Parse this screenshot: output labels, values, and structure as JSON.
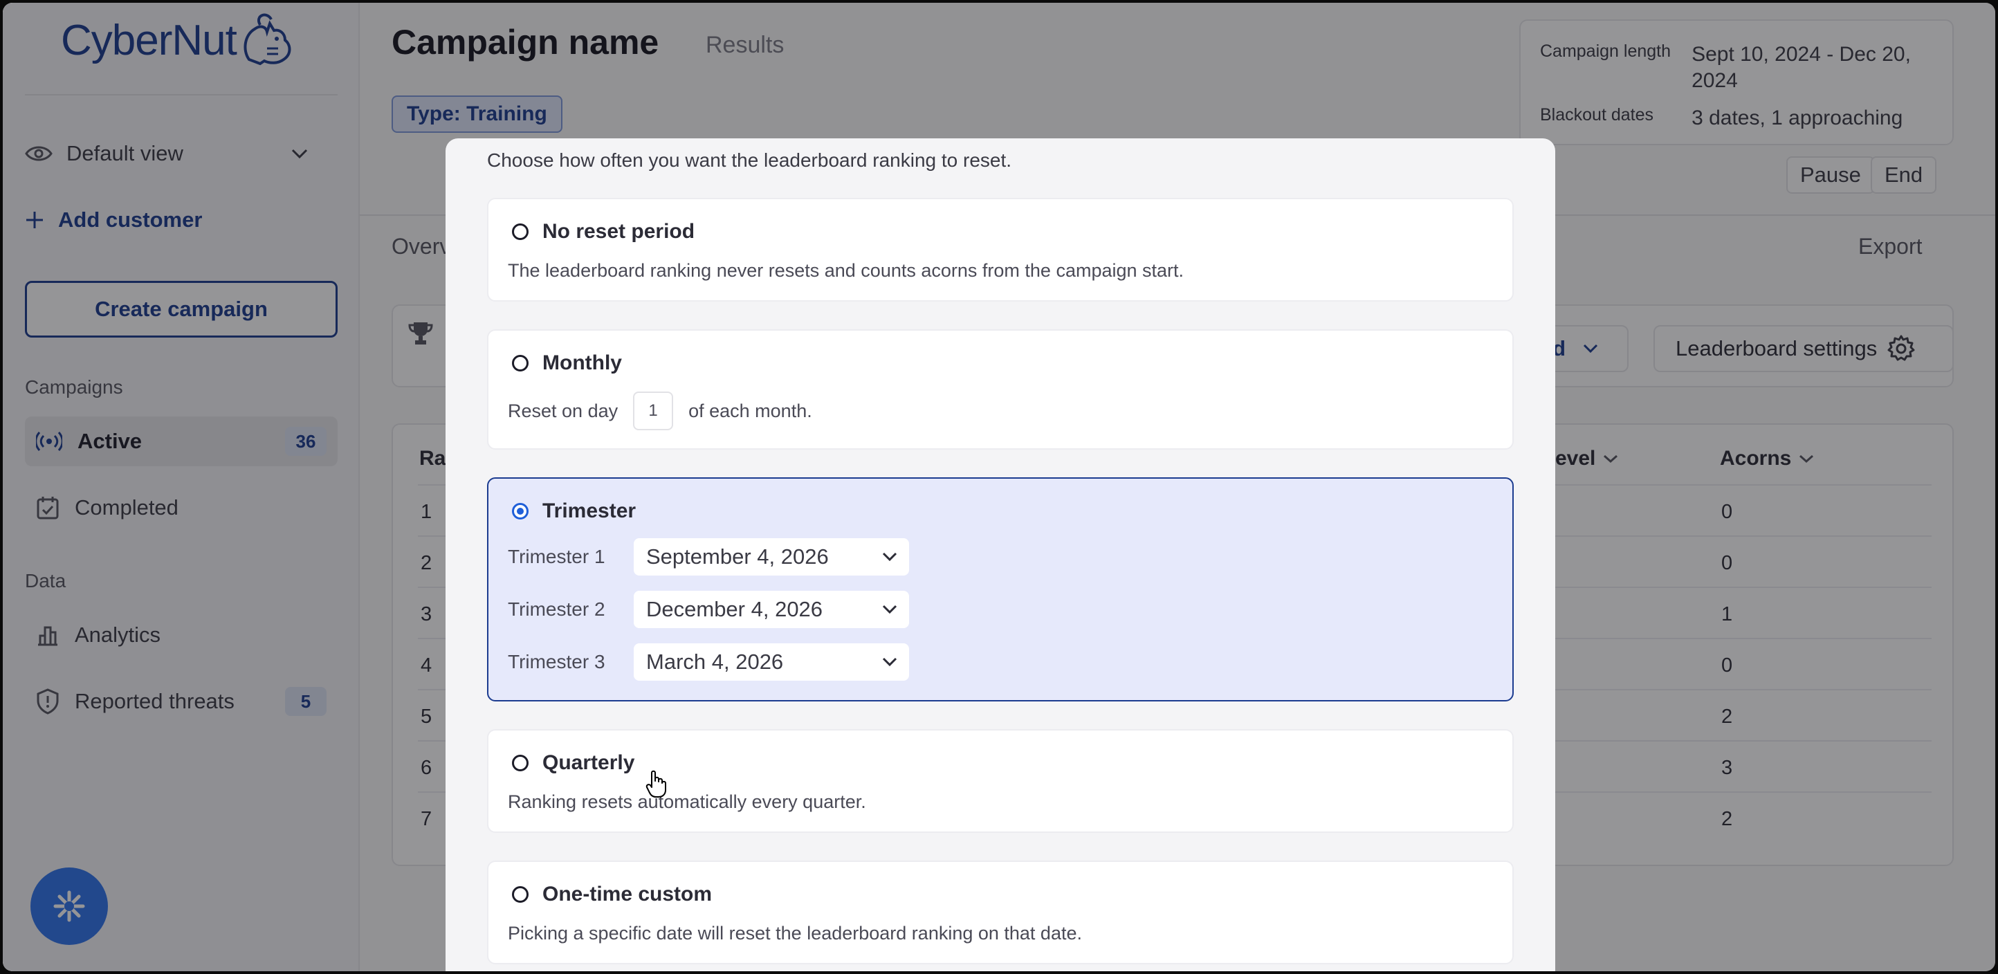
{
  "sidebar": {
    "logo_text": "CyberNut",
    "view_selector": "Default view",
    "add_customer": "Add customer",
    "create_campaign": "Create campaign",
    "campaigns_heading": "Campaigns",
    "nav_active": {
      "label": "Active",
      "count": "36"
    },
    "nav_completed": {
      "label": "Completed"
    },
    "data_heading": "Data",
    "nav_analytics": {
      "label": "Analytics"
    },
    "nav_threats": {
      "label": "Reported threats",
      "count": "5"
    }
  },
  "header": {
    "title": "Campaign name",
    "subtitle": "Results",
    "type_chip": "Type: Training",
    "campaign_length_label": "Campaign length",
    "campaign_length_value": "Sept 10, 2024 - Dec 20, 2024",
    "blackout_label": "Blackout dates",
    "blackout_value": "3 dates, 1 approaching",
    "pause_label": "Pause",
    "end_label": "End"
  },
  "tabs": {
    "overview_partial": "Overv",
    "export": "Export"
  },
  "leaderboard": {
    "filter_partial": "rd",
    "settings_label": "Leaderboard settings"
  },
  "table": {
    "col_rank_partial": "Ra",
    "col_level_partial": "evel",
    "col_acorns": "Acorns",
    "rows": [
      {
        "rank": "1",
        "acorns": "0"
      },
      {
        "rank": "2",
        "acorns": "0"
      },
      {
        "rank": "3",
        "acorns": "1"
      },
      {
        "rank": "4",
        "acorns": "0"
      },
      {
        "rank": "5",
        "acorns": "2"
      },
      {
        "rank": "6",
        "acorns": "3"
      },
      {
        "rank": "7",
        "acorns": "2"
      }
    ]
  },
  "modal": {
    "description": "Choose how often you want the leaderboard ranking to reset.",
    "options": {
      "none": {
        "title": "No reset period",
        "desc": "The leaderboard ranking never resets and counts acorns from the campaign start."
      },
      "monthly": {
        "title": "Monthly",
        "prefix": "Reset on day",
        "day": "1",
        "suffix": "of each month."
      },
      "trimester": {
        "title": "Trimester",
        "rows": [
          {
            "label": "Trimester 1",
            "value": "September 4, 2026"
          },
          {
            "label": "Trimester 2",
            "value": "December 4, 2026"
          },
          {
            "label": "Trimester 3",
            "value": "March 4, 2026"
          }
        ]
      },
      "quarterly": {
        "title": "Quarterly",
        "desc": "Ranking resets automatically every quarter."
      },
      "custom": {
        "title": "One-time custom",
        "desc": "Picking a specific date will reset the leaderboard ranking on that date."
      }
    },
    "selected": "trimester"
  },
  "colors": {
    "brand": "#1b3b8f",
    "accent": "#2f73ec",
    "selected_bg": "#e6e9fb"
  }
}
